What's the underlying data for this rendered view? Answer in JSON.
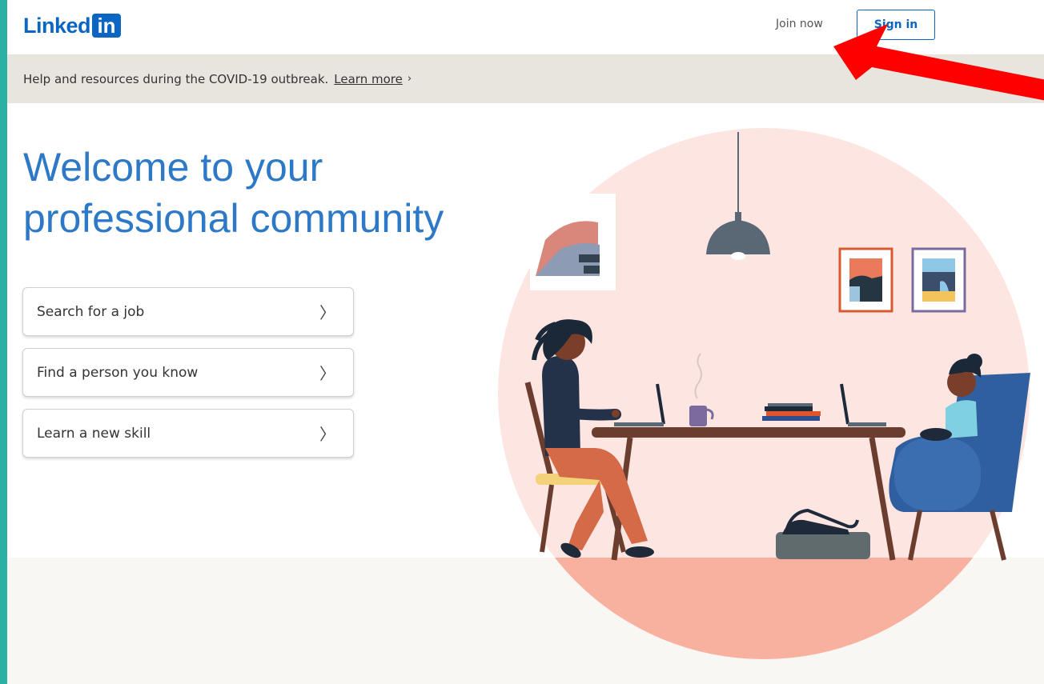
{
  "header": {
    "logo_word": "Linked",
    "logo_in": "in",
    "join_label": "Join now",
    "signin_label": "Sign in"
  },
  "banner": {
    "text": "Help and resources during the COVID-19 outbreak.",
    "link": "Learn more",
    "chevron": "›"
  },
  "hero": {
    "title": "Welcome to your professional community"
  },
  "options": [
    {
      "label": "Search for a job",
      "chevron": "〉"
    },
    {
      "label": "Find a person you know",
      "chevron": "〉"
    },
    {
      "label": "Learn a new skill",
      "chevron": "〉"
    }
  ],
  "colors": {
    "brand": "#0a66c2",
    "title": "#2d79c7",
    "frame_border": "#2bb0a4",
    "annotation_arrow": "#ff0000"
  },
  "icons": [
    "chevron-right-icon",
    "annotation-arrow"
  ]
}
